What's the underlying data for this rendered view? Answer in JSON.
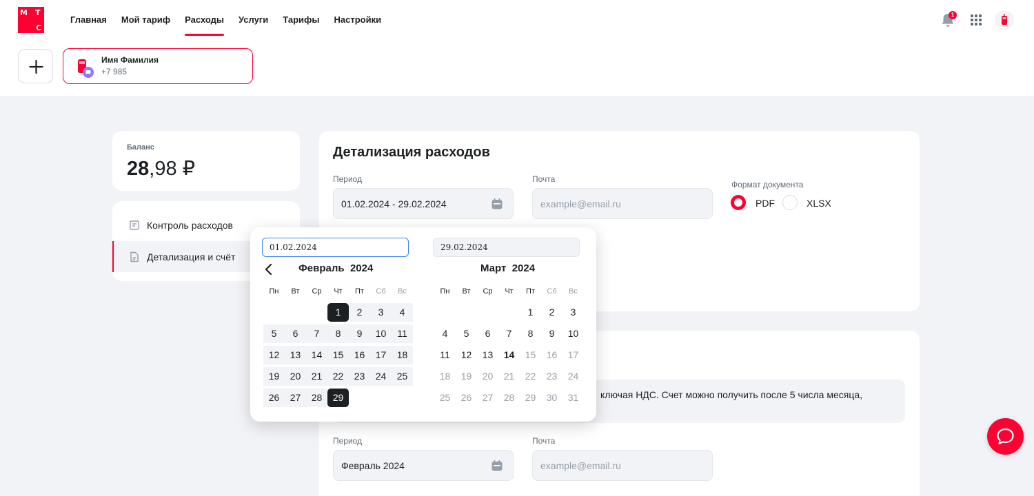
{
  "brand": {
    "letters": [
      "М",
      "Т",
      "С"
    ],
    "color": "#ff0032"
  },
  "nav": {
    "items": [
      "Главная",
      "Мой тариф",
      "Расходы",
      "Услуги",
      "Тарифы",
      "Настройки"
    ],
    "active_index": 2
  },
  "header": {
    "notifications_count": "1",
    "icons": [
      "bell-icon",
      "apps-grid-icon",
      "phone-avatar-icon"
    ]
  },
  "account": {
    "name": "Имя Фамилия",
    "phone": "+7 985"
  },
  "balance": {
    "label": "Баланс",
    "integer": "28",
    "fraction": ",98 ₽"
  },
  "sidebar": {
    "items": [
      {
        "label": "Контроль расходов",
        "icon": "list-icon"
      },
      {
        "label": "Детализация и счёт",
        "icon": "document-icon"
      }
    ]
  },
  "detail": {
    "title": "Детализация расходов",
    "period_label": "Период",
    "period_value": "01.02.2024 - 29.02.2024",
    "email_label": "Почта",
    "email_placeholder": "example@email.ru",
    "format_label": "Формат документа",
    "formats": [
      "PDF",
      "XLSX"
    ],
    "selected_format": "PDF"
  },
  "bill": {
    "info_text": "ключая НДС. Счет можно получить после 5 числа месяца,",
    "period_label": "Период",
    "period_value": "Февраль 2024",
    "email_label": "Почта",
    "email_placeholder": "example@email.ru"
  },
  "calendar": {
    "start_input": "01.02.2024",
    "end_input": "29.02.2024",
    "weekdays": [
      "Пн",
      "Вт",
      "Ср",
      "Чт",
      "Пт",
      "Сб",
      "Вс"
    ],
    "months": [
      {
        "name": "Февраль",
        "year": "2024",
        "first_weekday_index": 3,
        "days": 29,
        "range_start": 1,
        "range_end": 29,
        "today": null,
        "disabled_after": null
      },
      {
        "name": "Март",
        "year": "2024",
        "first_weekday_index": 4,
        "days": 31,
        "range_start": null,
        "range_end": null,
        "today": 14,
        "disabled_after": 14
      }
    ]
  }
}
